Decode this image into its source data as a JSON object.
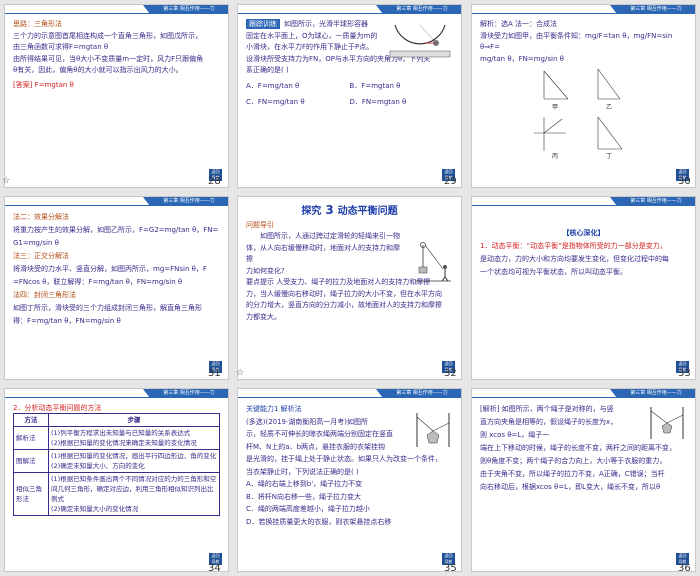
{
  "header_strip": "第三章  相互作用——力",
  "back_label": "返回\n导航",
  "slides": [
    {
      "num": "28",
      "lines": [
        "思路：三角形法",
        "三个力的示意图首尾相连构成一个直角三角形，如图戊所示，",
        "由三角函数可求得F=mgtan θ",
        "由所得结果可见，当θ大小不变质量m一定时，风力F只跟偏角",
        "θ有关，因此，偏角θ的大小就可以指示出风力的大小。"
      ],
      "answer": "[答案]  F=mgtan θ"
    },
    {
      "num": "29",
      "tag": "跟踪训练",
      "lines": [
        "如图所示，光滑半球形容器",
        "固定在水平面上，O为球心，一质量为m的",
        "小滑块，在水平力F的作用下静止于P点。",
        "设滑块所受支持力为FN，OP与水平方向的夹角为θ，下列关",
        "系正确的是(     )"
      ],
      "options": [
        "A．F=mg/tan θ",
        "B．F=mgtan θ",
        "C．FN=mg/tan θ",
        "D．FN=mgtan θ"
      ]
    },
    {
      "num": "30",
      "lines": [
        "解析：选A 法一：合成法",
        "滑块受力如图甲，由平衡条件知：mg/F=tan θ，mg/FN=sin θ⇒F=",
        "mg/tan θ，FN=mg/sin θ"
      ],
      "figs": [
        "甲",
        "乙",
        "丙",
        "丁"
      ]
    },
    {
      "num": "31",
      "lines": [
        "法二：效果分解法",
        "将重力按产生的效果分解，如图乙所示，F=G2=mg/tan θ，FN=",
        "G1=mg/sin θ",
        "法三：正交分解法",
        "将滑块受的力水平、竖直分解，如图丙所示，mg=FNsin θ，F",
        "=FNcos θ，联立解得：F=mg/tan θ，FN=mg/sin θ",
        "法四：封闭三角形法",
        "如图丁所示，滑块受的三个力组成封闭三角形，解直角三角形",
        "得：F=mg/tan θ，FN=mg/sin θ"
      ]
    },
    {
      "num": "32",
      "title_pre": "探究",
      "title_num": "3",
      "title_post": "动态平衡问题",
      "tag": "问题导引",
      "lines": [
        "如图所示，人通过跨过定滑轮的轻绳来引一物",
        "体，从人向右缓慢移动时，地面对人的支持力和摩擦",
        "力如何变化?",
        "要点提示  人受支力、绳子的拉力及地面对人的支持力和摩擦",
        "力，当人缓慢向右移动时，绳子拉力的大小不变，但在水平方向",
        "的分力增大，竖直方向的分力减小，故地面对人的支持力和摩擦",
        "力都变大。"
      ]
    },
    {
      "num": "33",
      "heading": "【核心深化】",
      "lines": [
        "1．动态平衡：“动态平衡”是指物体所受的力一部分是变力，",
        "是动态力，力的大小和方向均要发生变化，但变化过程中的每",
        "一个状态均可视为平衡状态，所以叫动态平衡。"
      ]
    },
    {
      "num": "34",
      "heading": "2．分析动态平衡问题的方法",
      "table_head": [
        "方法",
        "步骤"
      ],
      "table_rows": [
        [
          "解析法",
          "(1)列平衡方程求出未知量与已知量的关系表达式\n(2)根据已知量的变化情况来确定未知量的变化情况"
        ],
        [
          "图解法",
          "(1)根据已知量的变化情况，画出平行四边形边、角的变化\n(2)确定未知量大小、方向的变化"
        ],
        [
          "相似三角形法",
          "(1)根据已知条件画出两个不同情况对应的力的三角形和空间几何三角形，确定对应边，利用三角形相似知识列出比例式\n(2)确定未知量大小的变化情况"
        ]
      ]
    },
    {
      "num": "35",
      "tag": "关键能力1  解析法",
      "lines": [
        "(多选)(2019·湖南衡阳高一月考)如图所",
        "示，轻质不可伸长的晾衣绳两端分别固定在竖直",
        "杆M、N上的a、b两点，悬挂衣服的衣架挂钩",
        "是光滑的，挂于绳上处于静止状态。如果只人为改变一个条件，",
        "当衣架静止时，下列说法正确的是(     )"
      ],
      "options": [
        "A．绳的右端上移到b'，绳子拉力不变",
        "B．将杆N向右移一些，绳子拉力变大",
        "C．绳的两端高度差越小，绳子拉力越小",
        "D．若换挂质量更大的衣服，则衣架悬挂点右移"
      ]
    },
    {
      "num": "36",
      "lines": [
        "[解析]  如图所示，两个绳子是对称的，与竖",
        "直方向夹角是相等的，假设绳子的长度为x，",
        "则 xcos θ=L，绳子一",
        "端在上下移动的时候，绳子的长度不变，两杆之间的距离不变，",
        "则θ角度不变；两个绳子的合力向上，大小等于衣服的重力，",
        "由于夹角不变，所以绳子的拉力不变，A正确，C错误；当杆",
        "向右移动后，根据xcos θ=L，即L变大，绳长不变，所以θ"
      ]
    }
  ]
}
